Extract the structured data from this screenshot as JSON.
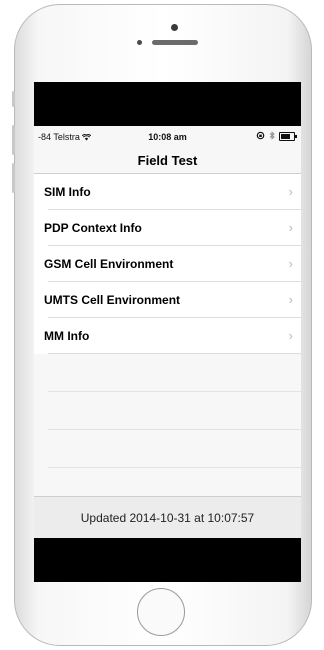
{
  "status_bar": {
    "carrier": "-84 Telstra",
    "wifi_icon": "wifi-icon",
    "time": "10:08 am",
    "icons": [
      "lock-rotation-icon",
      "bluetooth-icon",
      "battery-icon"
    ]
  },
  "nav": {
    "title": "Field Test"
  },
  "menu": {
    "items": [
      {
        "label": "SIM Info"
      },
      {
        "label": "PDP Context Info"
      },
      {
        "label": "GSM Cell Environment"
      },
      {
        "label": "UMTS Cell Environment"
      },
      {
        "label": "MM Info"
      }
    ],
    "chevron": "›"
  },
  "footer": {
    "updated_text": "Updated 2014-10-31 at 10:07:57"
  }
}
